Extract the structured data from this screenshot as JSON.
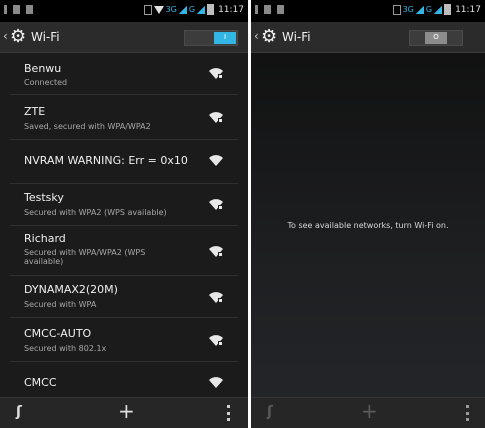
{
  "left_screen": {
    "status_bar": {
      "network": "3G",
      "time": "11:17"
    },
    "action_bar": {
      "title": "Wi-Fi",
      "toggle_label": "I",
      "toggle_state": "on"
    },
    "networks": [
      {
        "ssid": "Benwu",
        "status": "Connected",
        "secured": true
      },
      {
        "ssid": "ZTE",
        "status": "Saved, secured with WPA/WPA2",
        "secured": true
      },
      {
        "ssid": "NVRAM WARNING: Err = 0x10",
        "status": "",
        "secured": false
      },
      {
        "ssid": "Testsky",
        "status": "Secured with WPA2 (WPS available)",
        "secured": true
      },
      {
        "ssid": "Richard",
        "status": "Secured with WPA/WPA2 (WPS available)",
        "secured": true
      },
      {
        "ssid": "DYNAMAX2(20M)",
        "status": "Secured with WPA",
        "secured": true
      },
      {
        "ssid": "CMCC-AUTO",
        "status": "Secured with 802.1x",
        "secured": true
      },
      {
        "ssid": "CMCC",
        "status": "",
        "secured": false
      }
    ],
    "bottom_bar": {
      "wps": "wps-icon",
      "add": "+",
      "overflow": "overflow-menu-icon"
    }
  },
  "right_screen": {
    "status_bar": {
      "network": "3G",
      "time": "11:17"
    },
    "action_bar": {
      "title": "Wi-Fi",
      "toggle_label": "O",
      "toggle_state": "off"
    },
    "message": "To see available networks, turn Wi-Fi on.",
    "bottom_bar": {
      "add": "+"
    }
  },
  "colors": {
    "accent": "#33b5e5",
    "background": "#1b1b1b",
    "text": "#f0f0f0",
    "subtext": "#a8a8a8"
  }
}
